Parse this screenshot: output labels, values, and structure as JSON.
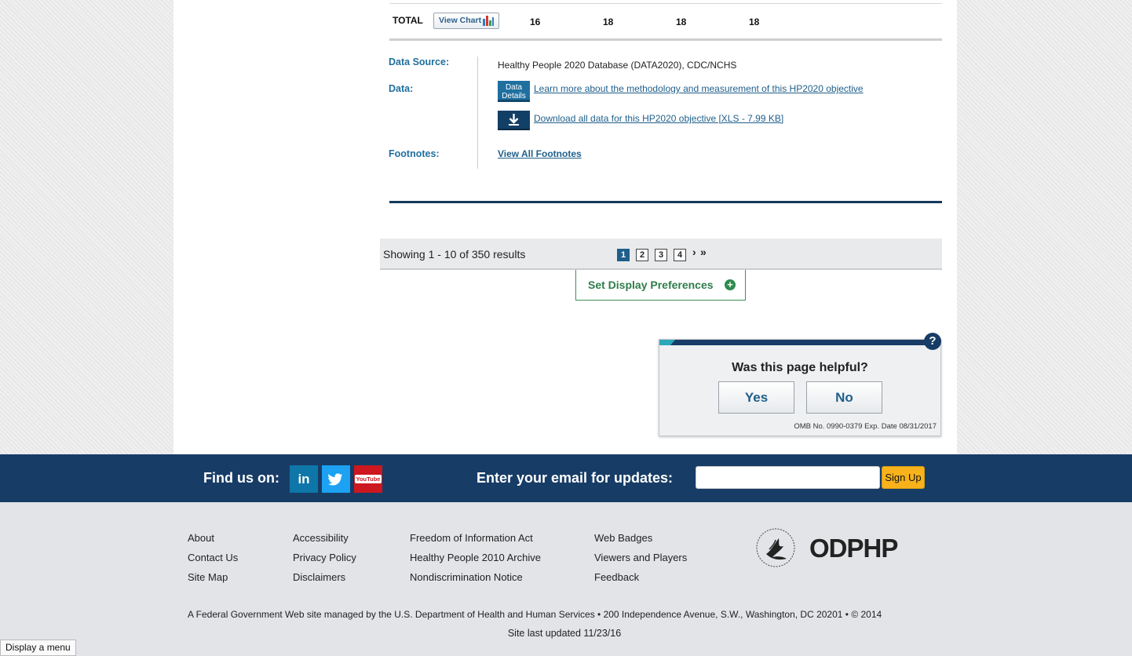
{
  "table": {
    "total_label": "TOTAL",
    "view_chart_label": "View Chart",
    "totals": [
      "16",
      "18",
      "18",
      "18"
    ]
  },
  "meta": {
    "data_source_label": "Data Source:",
    "data_source_value": "Healthy People 2020 Database (DATA2020), CDC/NCHS",
    "data_label": "Data:",
    "data_details_icon_text": "Data Details",
    "methodology_link": "Learn more about the methodology and measurement of this HP2020 objective",
    "download_link": "Download all data for this HP2020 objective [XLS - 7.99 KB]",
    "footnotes_label": "Footnotes:",
    "view_footnotes_link": "View All Footnotes"
  },
  "results": {
    "showing_text": "Showing 1 - 10 of 350 results",
    "pages": [
      "1",
      "2",
      "3",
      "4"
    ],
    "active_page": "1",
    "next": "›",
    "last": "»"
  },
  "preferences": {
    "label": "Set Display Preferences",
    "plus": "+"
  },
  "feedback": {
    "question": "Was this page helpful?",
    "yes": "Yes",
    "no": "No",
    "help": "?",
    "omb": "OMB No. 0990-0379    Exp. Date 08/31/2017"
  },
  "social": {
    "find_us": "Find us on:",
    "linkedin": "in",
    "youtube": "YouTube",
    "email_label": "Enter your email for updates:",
    "email_value": "",
    "signup": "Sign Up"
  },
  "footer": {
    "col1": [
      "About",
      "Contact Us",
      "Site Map"
    ],
    "col2": [
      "Accessibility",
      "Privacy Policy",
      "Disclaimers"
    ],
    "col3": [
      "Freedom of Information Act",
      "Healthy People 2010 Archive",
      "Nondiscrimination Notice"
    ],
    "col4": [
      "Web Badges",
      "Viewers and Players",
      "Feedback"
    ],
    "logo": "ODPHP",
    "note": "A Federal Government Web site managed by the U.S. Department of Health and Human Services • 200 Independence Avenue, S.W., Washington, DC 20201 • © 2014",
    "updated": "Site last updated 11/23/16"
  },
  "display_menu": "Display a menu",
  "colors": {
    "navy": "#173c66",
    "link_blue": "#1f5f8b",
    "green": "#2e7d4b",
    "signup_yellow": "#f8b21b",
    "linkedin": "#0e76a8",
    "twitter": "#1da1f2",
    "youtube": "#cc181e"
  }
}
